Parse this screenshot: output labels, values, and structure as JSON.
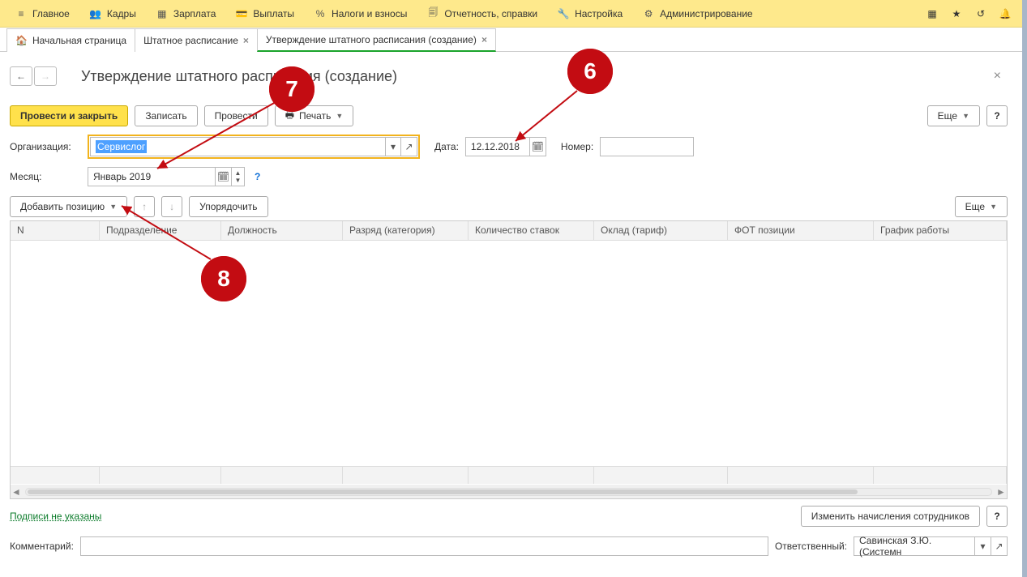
{
  "menu": {
    "items": [
      {
        "icon": "≡",
        "label": "Главное"
      },
      {
        "icon": "👥",
        "label": "Кадры"
      },
      {
        "icon": "▦",
        "label": "Зарплата"
      },
      {
        "icon": "💳",
        "label": "Выплаты"
      },
      {
        "icon": "%",
        "label": "Налоги и взносы"
      },
      {
        "icon": "🗐",
        "label": "Отчетность, справки"
      },
      {
        "icon": "🔧",
        "label": "Настройка"
      },
      {
        "icon": "⚙",
        "label": "Администрирование"
      }
    ]
  },
  "tabs": [
    {
      "icon": "🏠",
      "label": "Начальная страница",
      "closable": false,
      "active": false
    },
    {
      "icon": "",
      "label": "Штатное расписание",
      "closable": true,
      "active": false
    },
    {
      "icon": "",
      "label": "Утверждение штатного расписания (создание)",
      "closable": true,
      "active": true
    }
  ],
  "page": {
    "title": "Утверждение штатного расписания (создание)"
  },
  "actions": {
    "post_close": "Провести и закрыть",
    "write": "Записать",
    "post": "Провести",
    "print": "Печать",
    "more": "Еще",
    "help": "?"
  },
  "form": {
    "org_label": "Организация:",
    "org_value": "Сервислог",
    "date_label": "Дата:",
    "date_value": "12.12.2018",
    "number_label": "Номер:",
    "number_value": "",
    "month_label": "Месяц:",
    "month_value": "Январь 2019"
  },
  "table": {
    "add_position": "Добавить позицию",
    "order": "Упорядочить",
    "more": "Еще",
    "columns": [
      "N",
      "Подразделение",
      "Должность",
      "Разряд (категория)",
      "Количество ставок",
      "Оклад (тариф)",
      "ФОТ позиции",
      "График работы"
    ]
  },
  "footer": {
    "signs": "Подписи не указаны",
    "change_accruals": "Изменить начисления сотрудников",
    "comment_label": "Комментарий:",
    "responsible_label": "Ответственный:",
    "responsible_value": "Савинская З.Ю. (Системн"
  },
  "annotations": {
    "a6": "6",
    "a7": "7",
    "a8": "8"
  }
}
